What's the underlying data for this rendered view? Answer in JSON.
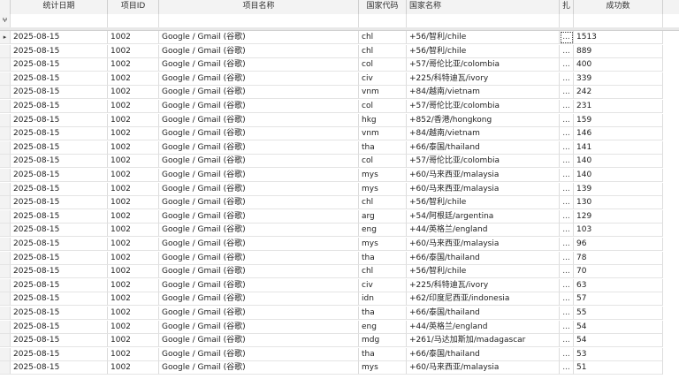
{
  "columns": [
    "",
    "统计日期",
    "项目ID",
    "项目名称",
    "国家代码",
    "国家名称",
    "扎",
    "成功数"
  ],
  "filter_icon": "ⵖ",
  "current_row_icon": "▸",
  "ellipsis": "...",
  "rows": [
    {
      "date": "2025-08-15",
      "pid": "1002",
      "pname": "Google / Gmail (谷歌)",
      "code": "chl",
      "country": "+56/智利/chile",
      "count": "1513"
    },
    {
      "date": "2025-08-15",
      "pid": "1002",
      "pname": "Google / Gmail (谷歌)",
      "code": "chl",
      "country": "+56/智利/chile",
      "count": "889"
    },
    {
      "date": "2025-08-15",
      "pid": "1002",
      "pname": "Google / Gmail (谷歌)",
      "code": "col",
      "country": "+57/哥伦比亚/colombia",
      "count": "400"
    },
    {
      "date": "2025-08-15",
      "pid": "1002",
      "pname": "Google / Gmail (谷歌)",
      "code": "civ",
      "country": "+225/科特迪瓦/ivory",
      "count": "339"
    },
    {
      "date": "2025-08-15",
      "pid": "1002",
      "pname": "Google / Gmail (谷歌)",
      "code": "vnm",
      "country": "+84/越南/vietnam",
      "count": "242"
    },
    {
      "date": "2025-08-15",
      "pid": "1002",
      "pname": "Google / Gmail (谷歌)",
      "code": "col",
      "country": "+57/哥伦比亚/colombia",
      "count": "231"
    },
    {
      "date": "2025-08-15",
      "pid": "1002",
      "pname": "Google / Gmail (谷歌)",
      "code": "hkg",
      "country": "+852/香港/hongkong",
      "count": "159"
    },
    {
      "date": "2025-08-15",
      "pid": "1002",
      "pname": "Google / Gmail (谷歌)",
      "code": "vnm",
      "country": "+84/越南/vietnam",
      "count": "146"
    },
    {
      "date": "2025-08-15",
      "pid": "1002",
      "pname": "Google / Gmail (谷歌)",
      "code": "tha",
      "country": "+66/泰国/thailand",
      "count": "141"
    },
    {
      "date": "2025-08-15",
      "pid": "1002",
      "pname": "Google / Gmail (谷歌)",
      "code": "col",
      "country": "+57/哥伦比亚/colombia",
      "count": "140"
    },
    {
      "date": "2025-08-15",
      "pid": "1002",
      "pname": "Google / Gmail (谷歌)",
      "code": "mys",
      "country": "+60/马来西亚/malaysia",
      "count": "140"
    },
    {
      "date": "2025-08-15",
      "pid": "1002",
      "pname": "Google / Gmail (谷歌)",
      "code": "mys",
      "country": "+60/马来西亚/malaysia",
      "count": "139"
    },
    {
      "date": "2025-08-15",
      "pid": "1002",
      "pname": "Google / Gmail (谷歌)",
      "code": "chl",
      "country": "+56/智利/chile",
      "count": "130"
    },
    {
      "date": "2025-08-15",
      "pid": "1002",
      "pname": "Google / Gmail (谷歌)",
      "code": "arg",
      "country": "+54/阿根廷/argentina",
      "count": "129"
    },
    {
      "date": "2025-08-15",
      "pid": "1002",
      "pname": "Google / Gmail (谷歌)",
      "code": "eng",
      "country": "+44/英格兰/england",
      "count": "103"
    },
    {
      "date": "2025-08-15",
      "pid": "1002",
      "pname": "Google / Gmail (谷歌)",
      "code": "mys",
      "country": "+60/马来西亚/malaysia",
      "count": "96"
    },
    {
      "date": "2025-08-15",
      "pid": "1002",
      "pname": "Google / Gmail (谷歌)",
      "code": "tha",
      "country": "+66/泰国/thailand",
      "count": "78"
    },
    {
      "date": "2025-08-15",
      "pid": "1002",
      "pname": "Google / Gmail (谷歌)",
      "code": "chl",
      "country": "+56/智利/chile",
      "count": "70"
    },
    {
      "date": "2025-08-15",
      "pid": "1002",
      "pname": "Google / Gmail (谷歌)",
      "code": "civ",
      "country": "+225/科特迪瓦/ivory",
      "count": "63"
    },
    {
      "date": "2025-08-15",
      "pid": "1002",
      "pname": "Google / Gmail (谷歌)",
      "code": "idn",
      "country": "+62/印度尼西亚/indonesia",
      "count": "57"
    },
    {
      "date": "2025-08-15",
      "pid": "1002",
      "pname": "Google / Gmail (谷歌)",
      "code": "tha",
      "country": "+66/泰国/thailand",
      "count": "55"
    },
    {
      "date": "2025-08-15",
      "pid": "1002",
      "pname": "Google / Gmail (谷歌)",
      "code": "eng",
      "country": "+44/英格兰/england",
      "count": "54"
    },
    {
      "date": "2025-08-15",
      "pid": "1002",
      "pname": "Google / Gmail (谷歌)",
      "code": "mdg",
      "country": "+261/马达加斯加/madagascar",
      "count": "54"
    },
    {
      "date": "2025-08-15",
      "pid": "1002",
      "pname": "Google / Gmail (谷歌)",
      "code": "tha",
      "country": "+66/泰国/thailand",
      "count": "53"
    },
    {
      "date": "2025-08-15",
      "pid": "1002",
      "pname": "Google / Gmail (谷歌)",
      "code": "mys",
      "country": "+60/马来西亚/malaysia",
      "count": "51"
    }
  ]
}
